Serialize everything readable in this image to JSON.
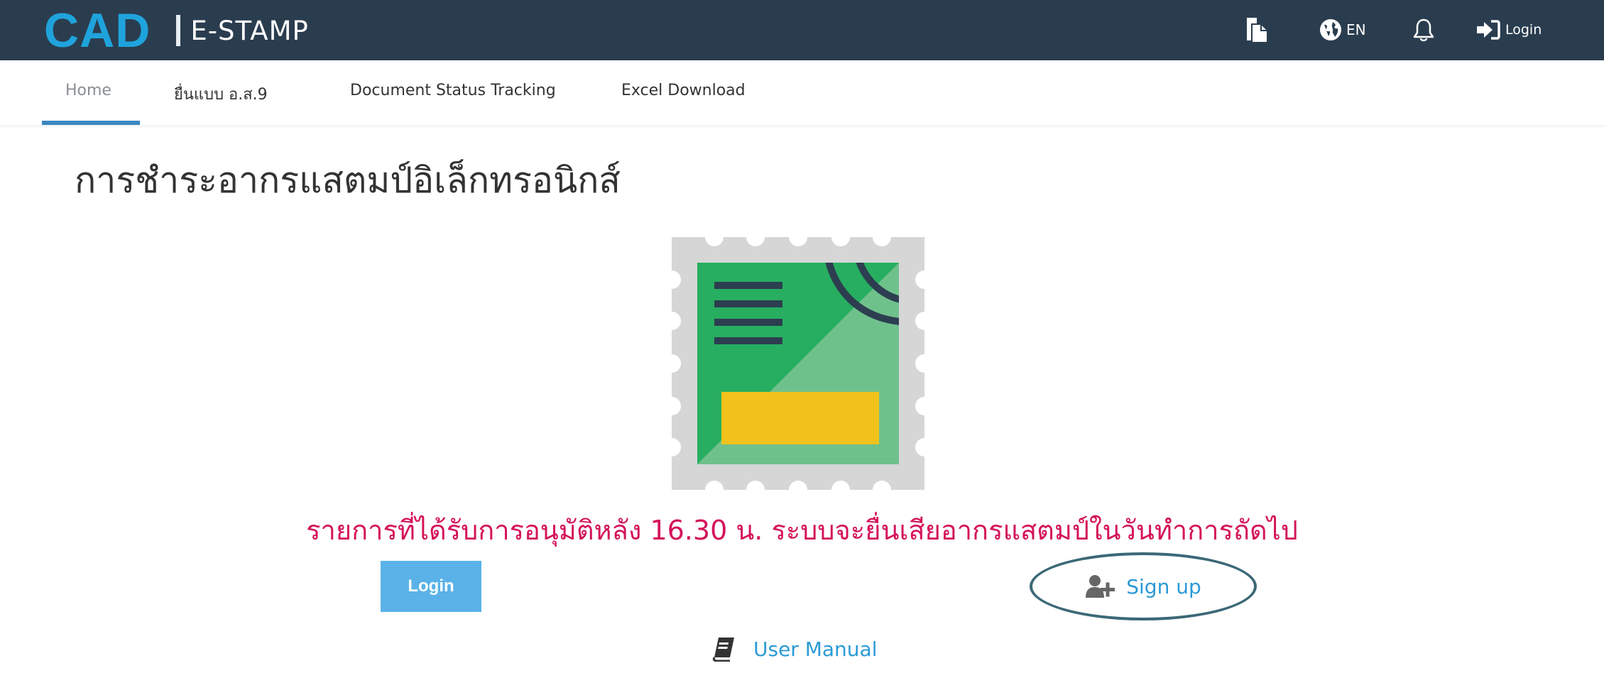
{
  "header": {
    "logo_main": "CAD",
    "logo_sub": "E-STAMP",
    "language_label": "EN",
    "login_label": "Login",
    "icons": [
      "document-icon",
      "globe-icon",
      "bell-icon",
      "sign-in-icon"
    ]
  },
  "nav": {
    "items": [
      {
        "label": "Home",
        "active": true
      },
      {
        "label": "ยื่นแบบ อ.ส.9",
        "active": false
      },
      {
        "label": "Document Status Tracking",
        "active": false
      },
      {
        "label": "Excel Download",
        "active": false
      }
    ]
  },
  "main": {
    "title": "การชำระอากรแสตมป์อิเล็กทรอนิกส์",
    "notice": "รายการที่ได้รับการอนุมัติหลัง 16.30 น. ระบบจะยื่นเสียอากรแสตมป์ในวันทำการถัดไป",
    "login_button": "Login",
    "signup_label": "Sign up",
    "manual_label": "User Manual"
  },
  "colors": {
    "topbar": "#2a3d4f",
    "brand_blue": "#1fa3dc",
    "notice": "#d4145a",
    "button": "#5ab2e8",
    "link": "#2b9ad5",
    "highlight_ring": "#3b6877"
  }
}
